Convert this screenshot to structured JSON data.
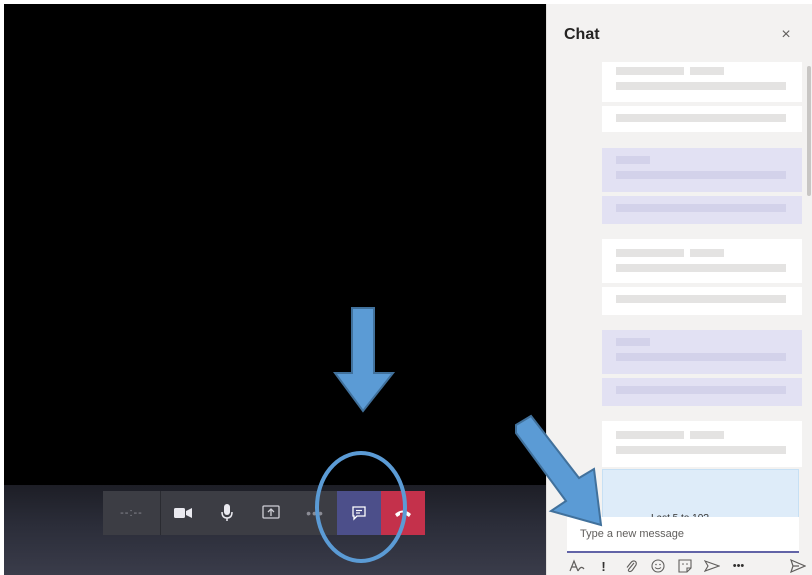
{
  "call": {
    "timer_label": "--:--",
    "controls": [
      {
        "name": "video",
        "icon": "video-camera-icon"
      },
      {
        "name": "mic",
        "icon": "microphone-icon"
      },
      {
        "name": "share",
        "icon": "share-screen-icon"
      },
      {
        "name": "more",
        "icon": "more-icon",
        "label": "•••"
      },
      {
        "name": "chat",
        "icon": "chat-icon"
      },
      {
        "name": "hangup",
        "icon": "hang-up-icon"
      }
    ]
  },
  "chat": {
    "title": "Chat",
    "close_label": "×",
    "last_message_partial": "Last 5 to 10?",
    "compose_placeholder": "Type a new message",
    "toolbar": [
      {
        "name": "format",
        "icon": "format-icon"
      },
      {
        "name": "important",
        "icon": "important-icon",
        "label": "!"
      },
      {
        "name": "attach",
        "icon": "paperclip-icon"
      },
      {
        "name": "emoji",
        "icon": "emoji-icon"
      },
      {
        "name": "sticker",
        "icon": "sticker-icon"
      },
      {
        "name": "meet",
        "icon": "meet-now-icon"
      },
      {
        "name": "more",
        "icon": "more-icon",
        "label": "•••"
      },
      {
        "name": "send",
        "icon": "send-icon"
      }
    ]
  },
  "colors": {
    "accent": "#6264a7",
    "hangup": "#c4314b",
    "annotation": "#5b9bd5",
    "annotation_outline": "#41719c"
  }
}
